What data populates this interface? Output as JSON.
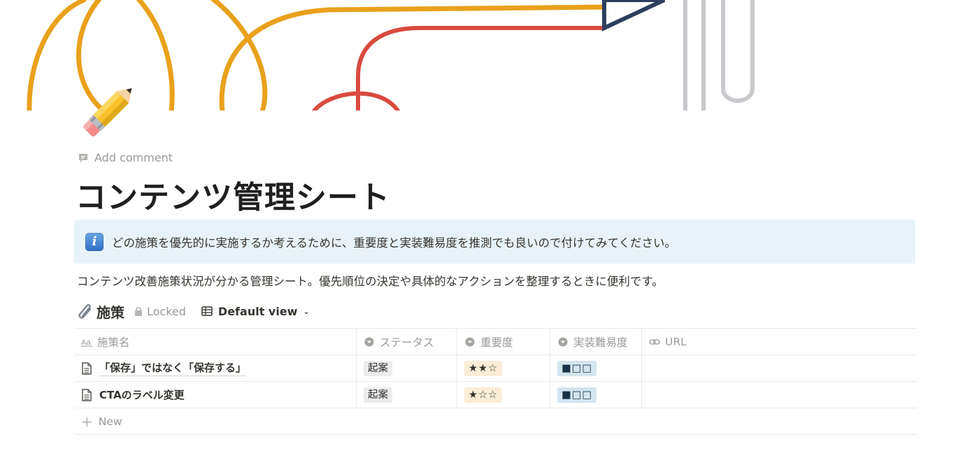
{
  "page": {
    "add_comment": "Add comment",
    "title": "コンテンツ管理シート",
    "page_icon": "pencil-icon",
    "callout": {
      "icon": "info-icon",
      "text": "どの施策を優先的に実施するか考えるために、重要度と実装難易度を推測でも良いので付けてみてください。"
    },
    "description": "コンテンツ改善施策状況が分かる管理シート。優先順位の決定や具体的なアクションを整理するときに便利です。"
  },
  "database": {
    "icon": "paperclip-icon",
    "title": "施策",
    "locked_label": "Locked",
    "view_label": "Default view",
    "columns": [
      {
        "label": "施策名",
        "icon": "text-property-icon"
      },
      {
        "label": "ステータス",
        "icon": "select-property-icon"
      },
      {
        "label": "重要度",
        "icon": "select-property-icon"
      },
      {
        "label": "実装難易度",
        "icon": "select-property-icon"
      },
      {
        "label": "URL",
        "icon": "link-property-icon"
      }
    ],
    "rows": [
      {
        "name": "「保存」ではなく「保存する」",
        "status": "起案",
        "importance": "★★☆",
        "difficulty": "■□□",
        "url": ""
      },
      {
        "name": "CTAのラベル変更",
        "status": "起案",
        "importance": "★☆☆",
        "difficulty": "■□□",
        "url": ""
      }
    ],
    "new_label": "New"
  },
  "colors": {
    "callout_bg": "#e7f3f8",
    "tag_gray": "#ebeced",
    "tag_yellow": "#fbedd6",
    "tag_blue": "#d3e5ef",
    "cover_orange": "#e9a11b",
    "cover_red": "#d94a3f",
    "cover_navy": "#2d3e5e",
    "cover_gray": "#c7c9cc"
  }
}
